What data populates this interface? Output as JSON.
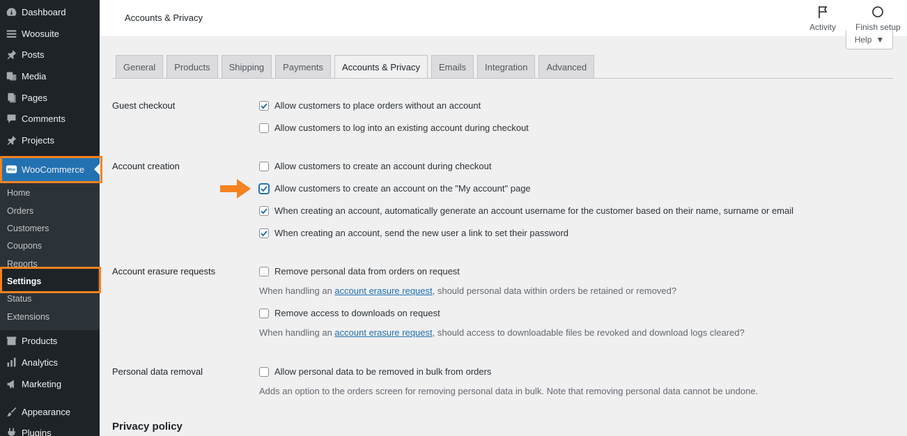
{
  "sidebar": {
    "items": [
      {
        "label": "Dashboard",
        "icon": "dashboard-icon"
      },
      {
        "label": "Woosuite",
        "icon": "menu-lines-icon"
      },
      {
        "label": "Posts",
        "icon": "pin-icon"
      },
      {
        "label": "Media",
        "icon": "media-icon"
      },
      {
        "label": "Pages",
        "icon": "pages-icon"
      },
      {
        "label": "Comments",
        "icon": "comment-icon"
      },
      {
        "label": "Projects",
        "icon": "pin-icon"
      }
    ],
    "woocommerce": {
      "label": "WooCommerce",
      "icon": "woo-icon"
    },
    "submenu": [
      "Home",
      "Orders",
      "Customers",
      "Coupons",
      "Reports",
      "Settings",
      "Status",
      "Extensions"
    ],
    "bottom_items": [
      {
        "label": "Products",
        "icon": "box-icon"
      },
      {
        "label": "Analytics",
        "icon": "bar-chart-icon"
      },
      {
        "label": "Marketing",
        "icon": "megaphone-icon"
      },
      {
        "label": "Appearance",
        "icon": "brush-icon"
      },
      {
        "label": "Plugins",
        "icon": "plug-icon"
      }
    ]
  },
  "header": {
    "title": "Accounts & Privacy",
    "activity": "Activity",
    "finish_setup": "Finish setup",
    "help": "Help"
  },
  "tabs": [
    "General",
    "Products",
    "Shipping",
    "Payments",
    "Accounts & Privacy",
    "Emails",
    "Integration",
    "Advanced"
  ],
  "active_tab": "Accounts & Privacy",
  "sections": {
    "guest_checkout": {
      "label": "Guest checkout",
      "options": [
        {
          "text": "Allow customers to place orders without an account",
          "checked": true
        },
        {
          "text": "Allow customers to log into an existing account during checkout",
          "checked": false
        }
      ]
    },
    "account_creation": {
      "label": "Account creation",
      "options": [
        {
          "text": "Allow customers to create an account during checkout",
          "checked": false
        },
        {
          "text": "Allow customers to create an account on the \"My account\" page",
          "checked": true
        },
        {
          "text": "When creating an account, automatically generate an account username for the customer based on their name, surname or email",
          "checked": true
        },
        {
          "text": "When creating an account, send the new user a link to set their password",
          "checked": true
        }
      ]
    },
    "erasure": {
      "label": "Account erasure requests",
      "opt1": "Remove personal data from orders on request",
      "desc1_pre": "When handling an ",
      "desc1_link": "account erasure request",
      "desc1_post": ", should personal data within orders be retained or removed?",
      "opt2": "Remove access to downloads on request",
      "desc2_pre": "When handling an ",
      "desc2_link": "account erasure request",
      "desc2_post": ", should access to downloadable files be revoked and download logs cleared?"
    },
    "removal": {
      "label": "Personal data removal",
      "opt": "Allow personal data to be removed in bulk from orders",
      "desc": "Adds an option to the orders screen for removing personal data in bulk. Note that removing personal data cannot be undone."
    },
    "privacy_policy": "Privacy policy"
  },
  "colors": {
    "accent": "#2271b1",
    "highlight": "#f6821f",
    "sidebar": "#1d2327"
  }
}
